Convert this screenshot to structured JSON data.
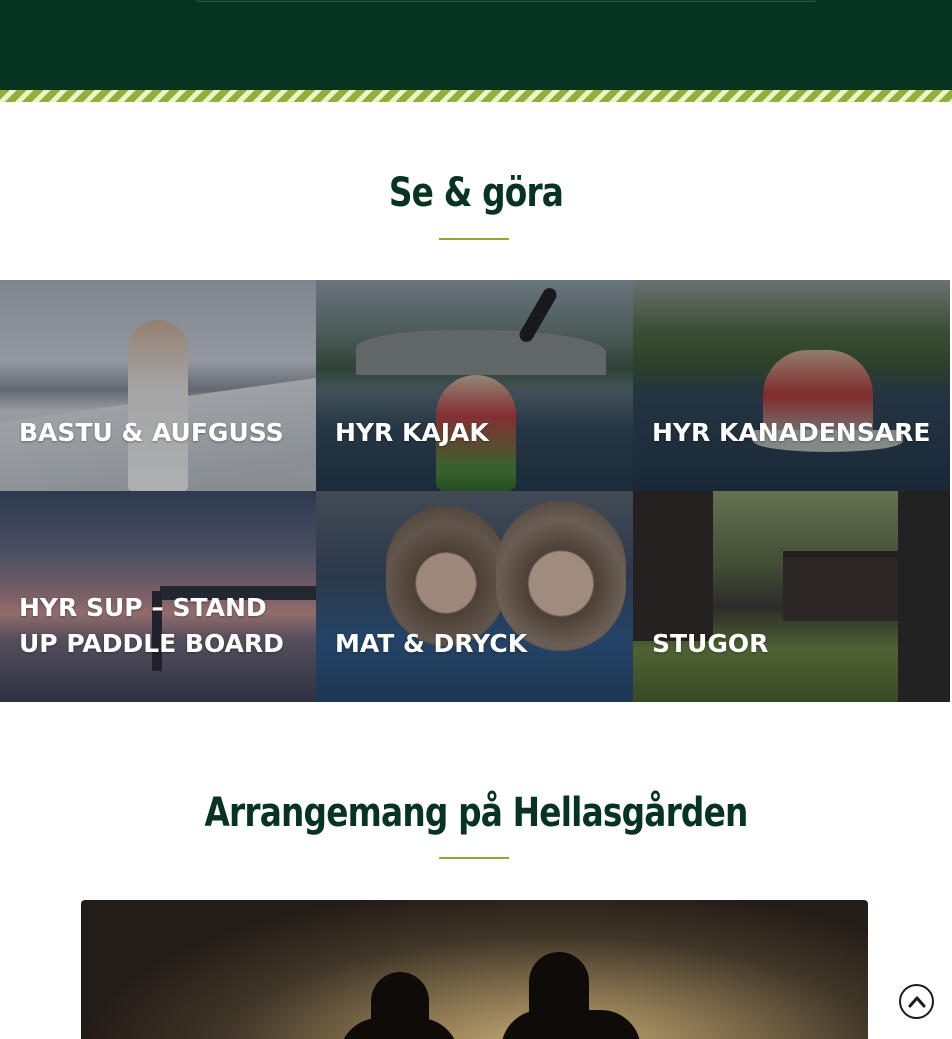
{
  "sections": {
    "activities": {
      "title": "Se & göra",
      "tiles": [
        {
          "label": "BASTU & AUFGUSS"
        },
        {
          "label": "HYR KAJAK"
        },
        {
          "label": "HYR KANADENSARE"
        },
        {
          "label": "HYR SUP – STAND UP PADDLE BOARD"
        },
        {
          "label": "MAT & DRYCK"
        },
        {
          "label": "STUGOR"
        }
      ]
    },
    "events": {
      "title": "Arrangemang på Hellasgården"
    }
  },
  "icons": {
    "scroll_top": "chevron-up-circle-icon"
  },
  "colors": {
    "header_bg": "#063420",
    "accent_green": "#8ea830",
    "title_text": "#063420"
  }
}
